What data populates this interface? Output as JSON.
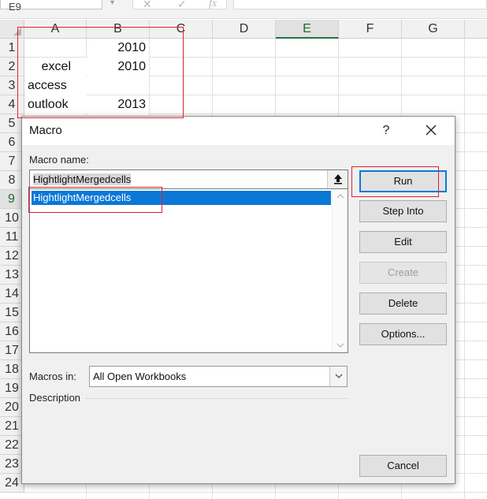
{
  "formula_bar": {
    "name_box": "E9",
    "cancel_icon": "✕",
    "enter_icon": "✓",
    "function_icon": "fx"
  },
  "columns": [
    "A",
    "B",
    "C",
    "D",
    "E",
    "F",
    "G"
  ],
  "selected_column": "E",
  "rows": [
    "1",
    "2",
    "3",
    "4",
    "5",
    "6",
    "7",
    "8",
    "9",
    "10",
    "11",
    "12",
    "13",
    "14",
    "15",
    "16",
    "17",
    "18",
    "19",
    "20",
    "21",
    "22",
    "23",
    "24"
  ],
  "selected_row": "9",
  "cells": {
    "B1": "2010",
    "A2": "excel",
    "B2": "2010",
    "A3": "access",
    "A4": "outlook",
    "B4": "2013"
  },
  "dialog": {
    "title": "Macro",
    "help_label": "?",
    "macro_name_label": "Macro name:",
    "macro_name_value": "HightlightMergedcells",
    "macro_list": [
      "HightlightMergedcells"
    ],
    "buttons": {
      "run": "Run",
      "step_into": "Step Into",
      "edit": "Edit",
      "create": "Create",
      "delete": "Delete",
      "options": "Options...",
      "cancel": "Cancel"
    },
    "macros_in_label": "Macros in:",
    "macros_in_value": "All Open Workbooks",
    "description_label": "Description"
  },
  "colors": {
    "selection_blue": "#0a78d7",
    "annotation_red": "#e0202e",
    "excel_green": "#217346"
  }
}
